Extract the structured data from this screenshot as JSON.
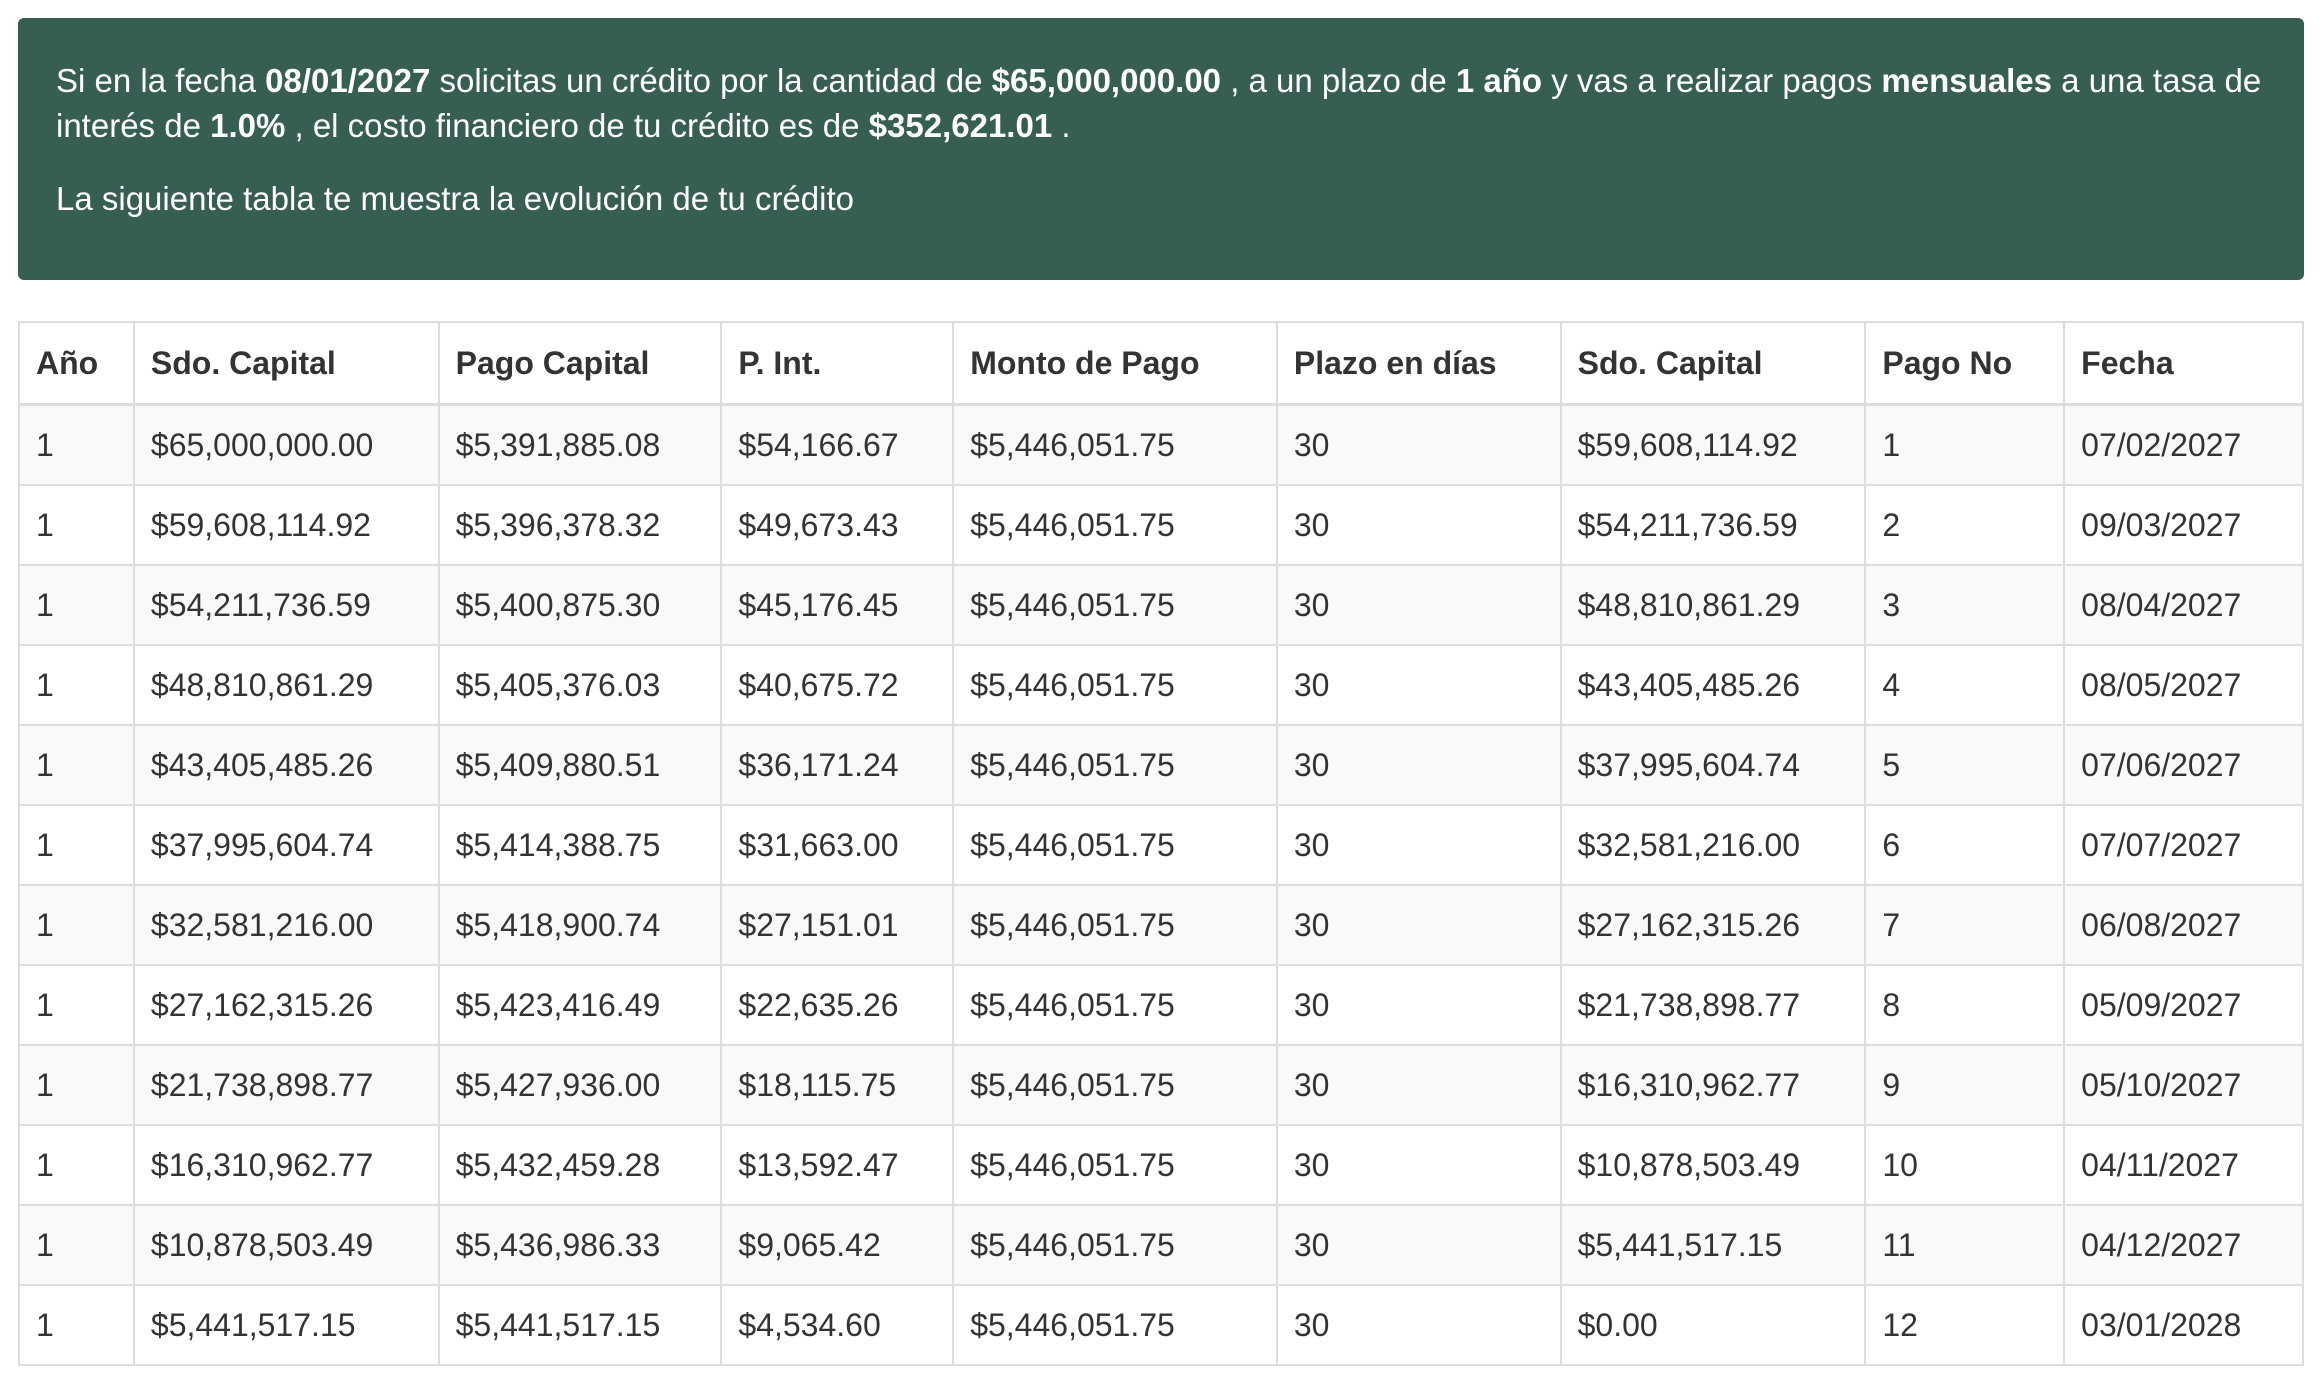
{
  "summary": {
    "prefix": "Si en la fecha ",
    "date": "08/01/2027",
    "t1": " solicitas un crédito por la cantidad de ",
    "amount": "$65,000,000.00",
    "t2": " , a un plazo de ",
    "term": "1 año",
    "t3": " y vas a realizar pagos ",
    "frequency": "mensuales",
    "t4": " a una tasa de interés de ",
    "rate": "1.0%",
    "t5": " , el costo financiero de tu crédito es de ",
    "cost": "$352,621.01",
    "t6": " .",
    "subtitle": "La siguiente tabla te muestra la evolución de tu crédito"
  },
  "table": {
    "headers": [
      "Año",
      "Sdo. Capital",
      "Pago Capital",
      "P. Int.",
      "Monto de Pago",
      "Plazo en días",
      "Sdo. Capital",
      "Pago No",
      "Fecha"
    ],
    "rows": [
      [
        "1",
        "$65,000,000.00",
        "$5,391,885.08",
        "$54,166.67",
        "$5,446,051.75",
        "30",
        "$59,608,114.92",
        "1",
        "07/02/2027"
      ],
      [
        "1",
        "$59,608,114.92",
        "$5,396,378.32",
        "$49,673.43",
        "$5,446,051.75",
        "30",
        "$54,211,736.59",
        "2",
        "09/03/2027"
      ],
      [
        "1",
        "$54,211,736.59",
        "$5,400,875.30",
        "$45,176.45",
        "$5,446,051.75",
        "30",
        "$48,810,861.29",
        "3",
        "08/04/2027"
      ],
      [
        "1",
        "$48,810,861.29",
        "$5,405,376.03",
        "$40,675.72",
        "$5,446,051.75",
        "30",
        "$43,405,485.26",
        "4",
        "08/05/2027"
      ],
      [
        "1",
        "$43,405,485.26",
        "$5,409,880.51",
        "$36,171.24",
        "$5,446,051.75",
        "30",
        "$37,995,604.74",
        "5",
        "07/06/2027"
      ],
      [
        "1",
        "$37,995,604.74",
        "$5,414,388.75",
        "$31,663.00",
        "$5,446,051.75",
        "30",
        "$32,581,216.00",
        "6",
        "07/07/2027"
      ],
      [
        "1",
        "$32,581,216.00",
        "$5,418,900.74",
        "$27,151.01",
        "$5,446,051.75",
        "30",
        "$27,162,315.26",
        "7",
        "06/08/2027"
      ],
      [
        "1",
        "$27,162,315.26",
        "$5,423,416.49",
        "$22,635.26",
        "$5,446,051.75",
        "30",
        "$21,738,898.77",
        "8",
        "05/09/2027"
      ],
      [
        "1",
        "$21,738,898.77",
        "$5,427,936.00",
        "$18,115.75",
        "$5,446,051.75",
        "30",
        "$16,310,962.77",
        "9",
        "05/10/2027"
      ],
      [
        "1",
        "$16,310,962.77",
        "$5,432,459.28",
        "$13,592.47",
        "$5,446,051.75",
        "30",
        "$10,878,503.49",
        "10",
        "04/11/2027"
      ],
      [
        "1",
        "$10,878,503.49",
        "$5,436,986.33",
        "$9,065.42",
        "$5,446,051.75",
        "30",
        "$5,441,517.15",
        "11",
        "04/12/2027"
      ],
      [
        "1",
        "$5,441,517.15",
        "$5,441,517.15",
        "$4,534.60",
        "$5,446,051.75",
        "30",
        "$0.00",
        "12",
        "03/01/2028"
      ]
    ]
  },
  "colors": {
    "panel_bg": "#365e52",
    "panel_text": "#ffffff",
    "table_border": "#dddddd",
    "row_stripe": "#f9f9f9"
  }
}
